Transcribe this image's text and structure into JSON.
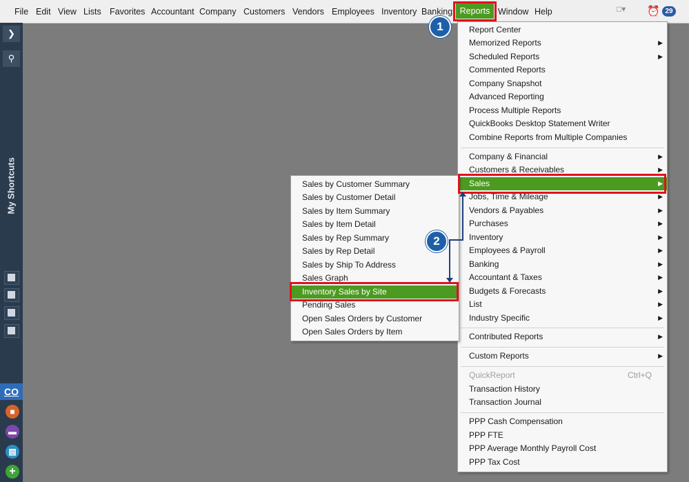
{
  "menubar": {
    "items": [
      "File",
      "Edit",
      "View",
      "Lists",
      "Favorites",
      "Accountant",
      "Company",
      "Customers",
      "Vendors",
      "Employees",
      "Inventory",
      "Banking",
      "Reports",
      "Window",
      "Help"
    ],
    "alert_count": "29"
  },
  "sidebar": {
    "label": "My Shortcuts",
    "company_tab": "CO"
  },
  "reports_menu": {
    "group1": [
      "Report Center",
      "Memorized Reports",
      "Scheduled Reports",
      "Commented Reports",
      "Company Snapshot",
      "Advanced Reporting",
      "Process Multiple Reports",
      "QuickBooks Desktop Statement Writer",
      "Combine Reports from Multiple Companies"
    ],
    "group2": [
      "Company & Financial",
      "Customers & Receivables",
      "Sales",
      "Jobs, Time & Mileage",
      "Vendors & Payables",
      "Purchases",
      "Inventory",
      "Employees & Payroll",
      "Banking",
      "Accountant & Taxes",
      "Budgets & Forecasts",
      "List",
      "Industry Specific"
    ],
    "group3": [
      "Contributed Reports"
    ],
    "group4": [
      "Custom Reports"
    ],
    "group5": [
      "QuickReport",
      "Transaction History",
      "Transaction Journal"
    ],
    "quickreport_shortcut": "Ctrl+Q",
    "group6": [
      "PPP Cash Compensation",
      "PPP FTE",
      "PPP Average Monthly Payroll Cost",
      "PPP Tax Cost"
    ]
  },
  "sales_submenu": {
    "items": [
      "Sales by Customer Summary",
      "Sales by Customer Detail",
      "Sales by Item Summary",
      "Sales by Item Detail",
      "Sales by Rep Summary",
      "Sales by Rep Detail",
      "Sales by Ship To Address",
      "Sales Graph",
      "Inventory Sales by Site",
      "Pending Sales",
      "Open Sales Orders by Customer",
      "Open Sales Orders by Item"
    ]
  },
  "steps": {
    "one": "1",
    "two": "2"
  },
  "colors": {
    "highlight": "#4d9a21",
    "annotation_box": "#e0111b",
    "step_circle": "#1f5fa8"
  }
}
